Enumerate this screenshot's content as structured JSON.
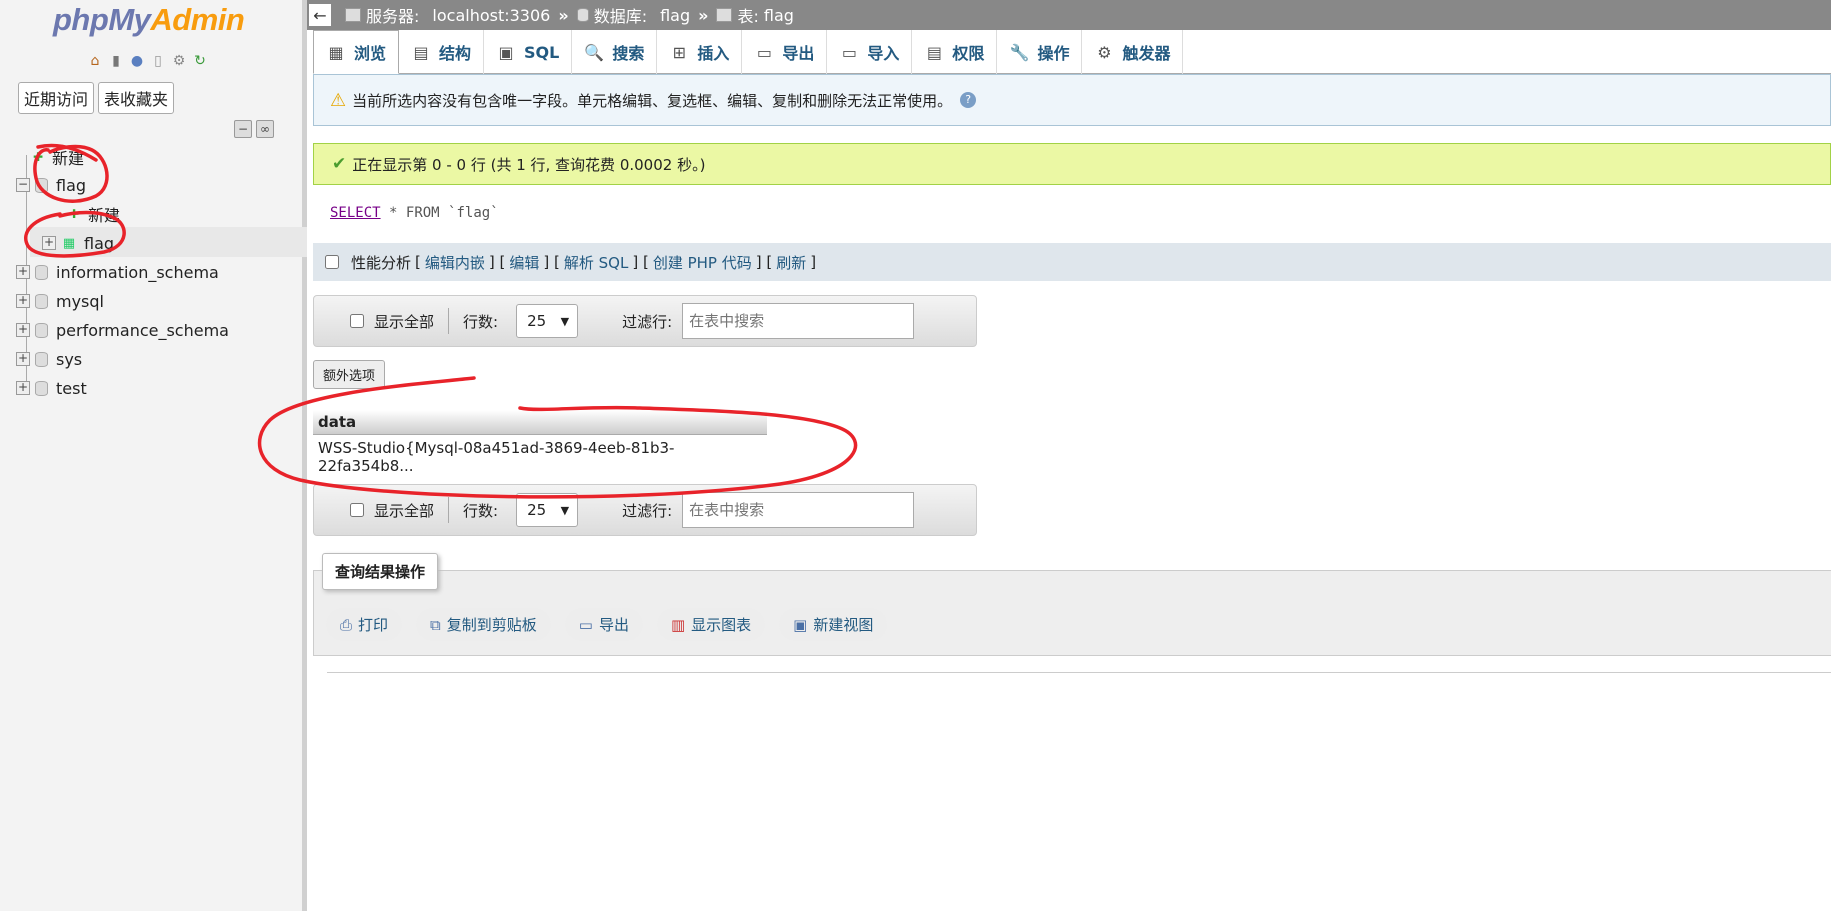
{
  "logo": {
    "php": "php",
    "my": "My",
    "admin": "Admin"
  },
  "sidebar": {
    "nav_tabs": [
      "近期访问",
      "表收藏夹"
    ],
    "tree": {
      "new_label": "新建",
      "db_flag": "flag",
      "db_flag_new": "新建",
      "table_flag": "flag",
      "databases": [
        "information_schema",
        "mysql",
        "performance_schema",
        "sys",
        "test"
      ]
    }
  },
  "breadcrumb": {
    "back": "←",
    "server_label": "服务器:",
    "server": "localhost:3306",
    "db_label": "数据库:",
    "db": "flag",
    "table_label": "表:",
    "table": "flag",
    "sep": "»"
  },
  "tabs": [
    {
      "label": "浏览",
      "icon": "▦"
    },
    {
      "label": "结构",
      "icon": "▤"
    },
    {
      "label": "SQL",
      "icon": "▣"
    },
    {
      "label": "搜索",
      "icon": "🔍"
    },
    {
      "label": "插入",
      "icon": "⊞"
    },
    {
      "label": "导出",
      "icon": "▭"
    },
    {
      "label": "导入",
      "icon": "▭"
    },
    {
      "label": "权限",
      "icon": "▤"
    },
    {
      "label": "操作",
      "icon": "🔧"
    },
    {
      "label": "触发器",
      "icon": "⚙"
    }
  ],
  "notice": {
    "text": "当前所选内容没有包含唯一字段。单元格编辑、复选框、编辑、复制和删除无法正常使用。",
    "help": "?"
  },
  "success": {
    "text": "正在显示第 0 - 0 行 (共 1 行, 查询花费 0.0002 秒。)"
  },
  "sql": {
    "keyword": "SELECT",
    "star": "*",
    "from": "FROM",
    "table": "`flag`"
  },
  "sql_links": {
    "profiling": "性能分析",
    "inline_edit": "编辑内嵌",
    "edit": "编辑",
    "explain": "解析 SQL",
    "php_code": "创建 PHP 代码",
    "refresh": "刷新"
  },
  "navigation": {
    "show_all": "显示全部",
    "rows_label": "行数:",
    "rows_value": "25",
    "filter_label": "过滤行:",
    "filter_placeholder": "在表中搜索"
  },
  "extra_options": "额外选项",
  "results": {
    "columns": [
      "data"
    ],
    "rows": [
      [
        "WSS-Studio{Mysql-08a451ad-3869-4eeb-81b3-22fa354b8..."
      ]
    ]
  },
  "query_ops": {
    "legend": "查询结果操作",
    "buttons": [
      "打印",
      "复制到剪贴板",
      "导出",
      "显示图表",
      "新建视图"
    ]
  },
  "colors": {
    "annotation": "#e8232a",
    "link": "#235a81",
    "success_bg": "#ebf8a4",
    "notice_bg": "#eef5fa"
  }
}
